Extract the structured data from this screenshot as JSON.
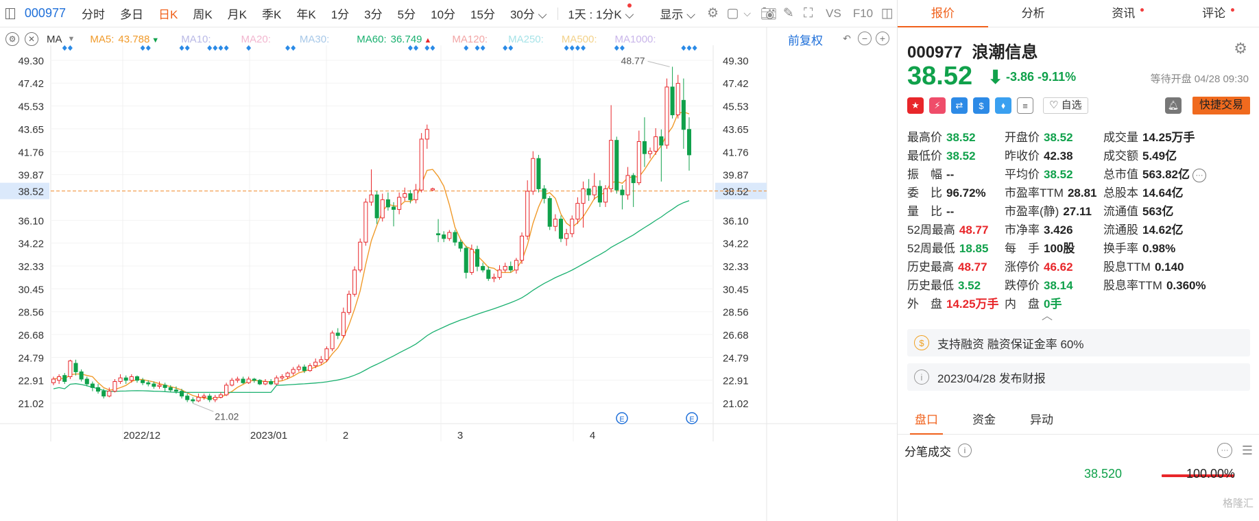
{
  "toolbar": {
    "code": "000977",
    "tabs": [
      "分时",
      "多日",
      "日K",
      "周K",
      "月K",
      "季K",
      "年K",
      "1分",
      "3分",
      "5分",
      "10分",
      "15分",
      "30分"
    ],
    "active_tab": "日K",
    "tab_30_arrow": "⌵",
    "period_selector": "1天 : 1分K",
    "display_label": "显示",
    "vs_label": "VS",
    "f10_label": "F10"
  },
  "indicator": {
    "name": "MA",
    "ma5_label": "MA5:",
    "ma5_value": "43.788",
    "ma5_arrow": "▼",
    "ma10_label": "MA10:",
    "ma20_label": "MA20:",
    "ma30_label": "MA30:",
    "ma60_label": "MA60:",
    "ma60_value": "36.749",
    "ma60_arrow": "▲",
    "ma120_label": "MA120:",
    "ma250_label": "MA250:",
    "ma500_label": "MA500:",
    "ma1000_label": "MA1000:",
    "restore_label": "前复权"
  },
  "colors": {
    "up": "#e8262a",
    "down": "#10a14b",
    "accent": "#f0601a",
    "link": "#1e6fd9",
    "ma5": "#f09a2a",
    "ma10": "#b9b9e6",
    "ma20": "#f2b6cf",
    "ma30": "#a7c8e8",
    "ma60": "#19b06f",
    "ma120": "#f2a6a6",
    "ma250": "#a6e3e8",
    "ma500": "#f3d28a",
    "ma1000": "#c9b6ea",
    "price_line": "#f08a2a",
    "signal": "#2a8ae6"
  },
  "chart_data": {
    "type": "candlestick",
    "y_ticks": [
      "49.30",
      "47.42",
      "45.53",
      "43.65",
      "41.76",
      "39.87",
      "38.52",
      "36.10",
      "34.22",
      "32.33",
      "30.45",
      "28.56",
      "26.68",
      "24.79",
      "22.91",
      "21.02"
    ],
    "y_range": [
      19.5,
      50.2
    ],
    "x_ticks": [
      "2022/12",
      "2023/01",
      "2",
      "3",
      "4"
    ],
    "current_price_label": "38.52",
    "high_label": "48.77",
    "low_label": "21.02",
    "event_markers": [
      "E",
      "E"
    ],
    "candles": [
      [
        22.7,
        23.0,
        22.5,
        23.2
      ],
      [
        22.9,
        23.2,
        22.6,
        23.4
      ],
      [
        23.3,
        22.8,
        22.6,
        23.5
      ],
      [
        23.2,
        24.5,
        23.0,
        24.6
      ],
      [
        24.3,
        23.6,
        23.3,
        24.6
      ],
      [
        23.6,
        23.0,
        22.8,
        23.8
      ],
      [
        23.0,
        22.6,
        22.4,
        23.2
      ],
      [
        22.6,
        22.3,
        22.0,
        22.8
      ],
      [
        22.3,
        22.0,
        21.8,
        22.6
      ],
      [
        22.0,
        21.6,
        21.4,
        22.2
      ],
      [
        21.6,
        22.0,
        21.5,
        22.3
      ],
      [
        22.0,
        22.8,
        21.9,
        23.0
      ],
      [
        22.8,
        23.1,
        22.6,
        23.4
      ],
      [
        23.1,
        22.9,
        22.6,
        23.3
      ],
      [
        22.9,
        23.2,
        22.7,
        23.4
      ],
      [
        23.2,
        22.9,
        22.7,
        23.3
      ],
      [
        22.9,
        22.7,
        22.5,
        23.1
      ],
      [
        22.7,
        22.6,
        22.4,
        22.9
      ],
      [
        22.6,
        22.4,
        22.2,
        22.8
      ],
      [
        22.4,
        22.5,
        22.2,
        22.8
      ],
      [
        22.5,
        22.3,
        22.0,
        22.7
      ],
      [
        22.3,
        22.1,
        21.9,
        22.5
      ],
      [
        22.1,
        22.0,
        21.8,
        22.4
      ],
      [
        22.0,
        21.6,
        21.4,
        22.2
      ],
      [
        21.6,
        21.3,
        21.1,
        21.8
      ],
      [
        21.3,
        21.2,
        21.0,
        21.5
      ],
      [
        21.2,
        21.5,
        21.1,
        21.8
      ],
      [
        21.5,
        21.6,
        21.3,
        21.8
      ],
      [
        21.6,
        21.3,
        21.1,
        21.8
      ],
      [
        21.3,
        21.5,
        21.1,
        21.7
      ],
      [
        21.5,
        21.7,
        21.4,
        21.9
      ],
      [
        21.7,
        22.5,
        21.6,
        22.7
      ],
      [
        22.5,
        22.9,
        22.4,
        23.1
      ],
      [
        22.9,
        23.0,
        22.7,
        23.2
      ],
      [
        23.0,
        22.7,
        22.6,
        23.2
      ],
      [
        22.7,
        23.0,
        22.6,
        23.2
      ],
      [
        23.0,
        22.9,
        22.7,
        23.1
      ],
      [
        22.9,
        22.6,
        22.5,
        23.0
      ],
      [
        22.6,
        22.8,
        22.5,
        23.0
      ],
      [
        22.8,
        22.6,
        22.5,
        23.0
      ],
      [
        22.6,
        23.1,
        22.5,
        23.3
      ],
      [
        23.1,
        23.2,
        22.9,
        23.4
      ],
      [
        23.2,
        23.5,
        23.0,
        23.6
      ],
      [
        23.5,
        23.8,
        23.3,
        24.0
      ],
      [
        23.8,
        24.0,
        23.6,
        24.2
      ],
      [
        24.0,
        23.7,
        23.5,
        24.2
      ],
      [
        23.7,
        24.1,
        23.6,
        24.3
      ],
      [
        24.1,
        24.4,
        23.9,
        24.7
      ],
      [
        24.4,
        24.6,
        24.2,
        24.9
      ],
      [
        24.6,
        25.5,
        24.4,
        25.7
      ],
      [
        25.5,
        26.8,
        25.3,
        27.0
      ],
      [
        26.8,
        26.6,
        26.3,
        27.2
      ],
      [
        26.6,
        28.5,
        26.4,
        28.9
      ],
      [
        28.5,
        30.0,
        28.3,
        30.3
      ],
      [
        30.0,
        32.0,
        29.8,
        32.3
      ],
      [
        32.0,
        34.3,
        31.8,
        34.6
      ],
      [
        34.3,
        37.6,
        34.0,
        37.9
      ],
      [
        37.6,
        38.2,
        37.3,
        40.3
      ],
      [
        38.2,
        36.3,
        35.8,
        38.5
      ],
      [
        36.3,
        37.8,
        36.0,
        38.3
      ],
      [
        37.8,
        37.2,
        36.9,
        38.4
      ],
      [
        37.2,
        37.0,
        35.6,
        37.6
      ],
      [
        37.0,
        38.0,
        36.6,
        38.4
      ],
      [
        38.0,
        38.3,
        37.7,
        38.8
      ],
      [
        38.3,
        37.8,
        37.5,
        38.6
      ],
      [
        37.8,
        38.6,
        37.5,
        39.1
      ],
      [
        38.6,
        42.8,
        38.4,
        43.3
      ],
      [
        42.8,
        43.6,
        42.0,
        44.0
      ],
      [
        38.6,
        38.7,
        38.5,
        38.8
      ],
      [
        35.0,
        34.9,
        34.3,
        36.2
      ],
      [
        34.9,
        34.6,
        34.3,
        35.2
      ],
      [
        34.6,
        35.1,
        34.4,
        35.3
      ],
      [
        35.1,
        34.3,
        34.0,
        35.3
      ],
      [
        34.3,
        33.8,
        33.5,
        34.5
      ],
      [
        33.8,
        31.8,
        31.3,
        34.0
      ],
      [
        31.8,
        33.7,
        31.6,
        34.1
      ],
      [
        33.7,
        32.3,
        31.9,
        34.0
      ],
      [
        32.3,
        32.0,
        31.8,
        32.6
      ],
      [
        32.0,
        31.3,
        31.1,
        32.3
      ],
      [
        31.3,
        31.4,
        31.0,
        31.7
      ],
      [
        31.4,
        32.0,
        31.2,
        32.4
      ],
      [
        32.0,
        32.3,
        31.8,
        32.6
      ],
      [
        32.3,
        32.0,
        31.8,
        32.7
      ],
      [
        32.0,
        32.8,
        31.7,
        33.0
      ],
      [
        32.8,
        34.8,
        32.5,
        35.1
      ],
      [
        34.8,
        38.5,
        34.5,
        39.4
      ],
      [
        38.5,
        41.2,
        38.2,
        41.8
      ],
      [
        41.2,
        38.7,
        38.4,
        41.5
      ],
      [
        38.7,
        37.9,
        37.5,
        39.0
      ],
      [
        37.9,
        35.6,
        35.3,
        38.1
      ],
      [
        35.6,
        36.2,
        35.2,
        36.6
      ],
      [
        36.2,
        34.6,
        34.3,
        36.5
      ],
      [
        34.6,
        35.0,
        34.0,
        35.4
      ],
      [
        35.0,
        36.2,
        34.7,
        36.5
      ],
      [
        36.2,
        37.5,
        35.8,
        38.0
      ],
      [
        37.5,
        38.7,
        35.5,
        39.3
      ],
      [
        38.7,
        38.2,
        37.7,
        39.5
      ],
      [
        38.2,
        38.9,
        37.8,
        40.0
      ],
      [
        38.9,
        37.6,
        37.2,
        39.4
      ],
      [
        37.6,
        38.7,
        37.2,
        39.0
      ],
      [
        38.7,
        42.7,
        38.4,
        45.6
      ],
      [
        42.7,
        38.6,
        38.3,
        43.0
      ],
      [
        38.6,
        38.2,
        37.0,
        39.0
      ],
      [
        38.2,
        39.8,
        37.8,
        40.5
      ],
      [
        39.8,
        39.2,
        37.2,
        40.0
      ],
      [
        39.2,
        42.6,
        39.0,
        43.5
      ],
      [
        42.6,
        41.6,
        40.5,
        44.6
      ],
      [
        41.6,
        41.8,
        41.2,
        42.1
      ],
      [
        41.8,
        43.0,
        41.5,
        43.7
      ],
      [
        43.0,
        42.3,
        39.3,
        43.6
      ],
      [
        42.3,
        47.1,
        42.0,
        47.8
      ],
      [
        47.1,
        44.8,
        44.5,
        48.77
      ],
      [
        44.8,
        47.4,
        44.5,
        48.1
      ],
      [
        46.0,
        43.6,
        42.0,
        47.8
      ],
      [
        43.6,
        41.5,
        40.2,
        44.6
      ]
    ]
  },
  "panel": {
    "tabs": [
      "报价",
      "分析",
      "资讯",
      "评论"
    ],
    "code": "000977",
    "name": "浪潮信息",
    "price": "38.52",
    "arrow": "⬇",
    "change": "-3.86",
    "pct": "-9.11%",
    "status": "等待开盘 04/28 09:30",
    "fav_label": "♡ 自选",
    "quick_trade": "快捷交易",
    "stats": [
      [
        {
          "l": "最高价",
          "v": "38.52",
          "c": "down"
        },
        {
          "l": "开盘价",
          "v": "38.52",
          "c": "down"
        },
        {
          "l": "成交量",
          "v": "14.25万手",
          "c": "neu"
        }
      ],
      [
        {
          "l": "最低价",
          "v": "38.52",
          "c": "down"
        },
        {
          "l": "昨收价",
          "v": "42.38",
          "c": "neu"
        },
        {
          "l": "成交额",
          "v": "5.49亿",
          "c": "neu"
        }
      ],
      [
        {
          "l": "振　幅",
          "v": "--",
          "c": "neu"
        },
        {
          "l": "平均价",
          "v": "38.52",
          "c": "down"
        },
        {
          "l": "总市值",
          "v": "563.82亿",
          "c": "neu"
        }
      ],
      [
        {
          "l": "委　比",
          "v": "96.72%",
          "c": "neu"
        },
        {
          "l": "市盈率TTM",
          "v": "28.81",
          "c": "neu"
        },
        {
          "l": "总股本",
          "v": "14.64亿",
          "c": "neu"
        }
      ],
      [
        {
          "l": "量　比",
          "v": "--",
          "c": "neu"
        },
        {
          "l": "市盈率(静)",
          "v": "27.11",
          "c": "neu"
        },
        {
          "l": "流通值",
          "v": "563亿",
          "c": "neu"
        }
      ],
      [
        {
          "l": "52周最高",
          "v": "48.77",
          "c": "up"
        },
        {
          "l": "市净率",
          "v": "3.426",
          "c": "neu"
        },
        {
          "l": "流通股",
          "v": "14.62亿",
          "c": "neu"
        }
      ],
      [
        {
          "l": "52周最低",
          "v": "18.85",
          "c": "down"
        },
        {
          "l": "每　手",
          "v": "100股",
          "c": "neu"
        },
        {
          "l": "换手率",
          "v": "0.98%",
          "c": "neu"
        }
      ],
      [
        {
          "l": "历史最高",
          "v": "48.77",
          "c": "up"
        },
        {
          "l": "涨停价",
          "v": "46.62",
          "c": "up"
        },
        {
          "l": "股息TTM",
          "v": "0.140",
          "c": "neu"
        }
      ],
      [
        {
          "l": "历史最低",
          "v": "3.52",
          "c": "down"
        },
        {
          "l": "跌停价",
          "v": "38.14",
          "c": "down"
        },
        {
          "l": "股息率TTM",
          "v": "0.360%",
          "c": "neu"
        }
      ],
      [
        {
          "l": "外　盘",
          "v": "14.25万手",
          "c": "up"
        },
        {
          "l": "内　盘",
          "v": "0手",
          "c": "down"
        },
        {
          "l": "",
          "v": "",
          "c": "neu"
        }
      ]
    ],
    "margin_info": "支持融资 融资保证金率 60%",
    "report_info": "2023/04/28  发布财报",
    "bottom_tabs": [
      "盘口",
      "资金",
      "异动"
    ],
    "tick_title": "分笔成交",
    "tick_price": "38.520",
    "tick_pct": "100.00%",
    "tick_fill_pct": 100,
    "watermark": "格隆汇"
  }
}
